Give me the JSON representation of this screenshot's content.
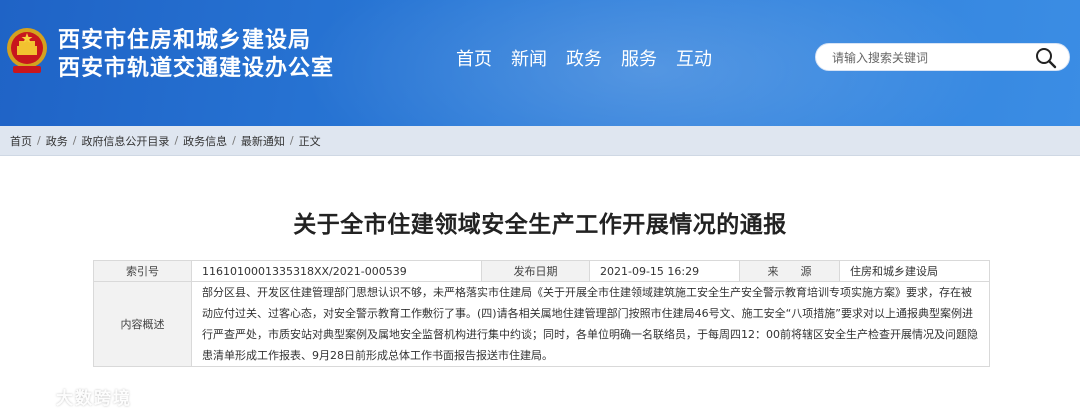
{
  "header": {
    "title_line1": "西安市住房和城乡建设局",
    "title_line2": "西安市轨道交通建设办公室",
    "emblem_icon": "national-emblem-icon",
    "bg_color": "#2a72d0"
  },
  "nav": {
    "items": [
      {
        "label": "首页"
      },
      {
        "label": "新闻"
      },
      {
        "label": "政务"
      },
      {
        "label": "服务"
      },
      {
        "label": "互动"
      }
    ]
  },
  "search": {
    "placeholder": "请输入搜索关键词",
    "icon": "search-icon"
  },
  "breadcrumb": {
    "items": [
      "首页",
      "政务",
      "政府信息公开目录",
      "政务信息",
      "最新通知",
      "正文"
    ],
    "separator": "/"
  },
  "article": {
    "title": "关于全市住建领域安全生产工作开展情况的通报",
    "index_label": "索引号",
    "index_value": "1161010001335318XX/2021-000539",
    "date_label": "发布日期",
    "date_value": "2021-09-15 16:29",
    "source_label": "来　　源",
    "source_value": "住房和城乡建设局",
    "summary_label": "内容概述",
    "summary_text": "部分区县、开发区住建管理部门思想认识不够，未严格落实市住建局《关于开展全市住建领域建筑施工安全生产安全警示教育培训专项实施方案》要求，存在被动应付过关、过客心态，对安全警示教育工作敷衍了事。(四)请各相关属地住建管理部门按照市住建局46号文、施工安全“八项措施”要求对以上通报典型案例进行严查严处，市质安站对典型案例及属地安全监督机构进行集中约谈；同时，各单位明确一名联络员，于每周四12：00前将辖区安全生产检查开展情况及问题隐患清单形成工作报表、9月28日前形成总体工作书面报告报送市住建局。"
  },
  "watermark": {
    "text": "大数跨境",
    "icon": "watermark-logo-icon"
  }
}
